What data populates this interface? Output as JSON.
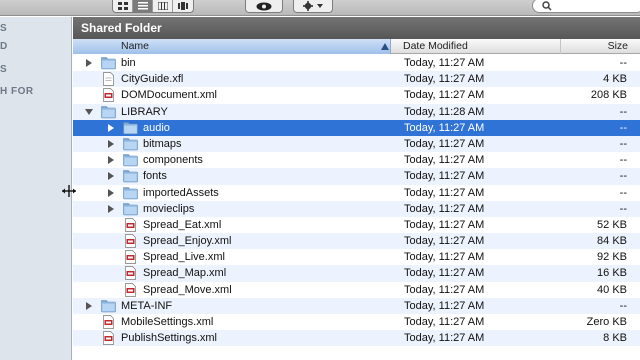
{
  "toolbar": {
    "view_buttons": [
      "icon-view",
      "list-view",
      "column-view",
      "coverflow-view"
    ],
    "active_view": 1
  },
  "sidebar": {
    "items": [
      "S",
      "D",
      "S",
      "H FOR"
    ]
  },
  "window": {
    "title": "Shared Folder"
  },
  "columns": {
    "name": "Name",
    "date": "Date Modified",
    "size": "Size"
  },
  "colors": {
    "selection": "#2f73d6",
    "title_bar": "#5e5e5e",
    "alt_row": "#edf3fe",
    "sidebar": "#dde4ec"
  },
  "rows": [
    {
      "name": "bin",
      "date": "Today, 11:27 AM",
      "size": "--",
      "type": "folder",
      "level": 0,
      "disclosure": "closed"
    },
    {
      "name": "CityGuide.xfl",
      "date": "Today, 11:27 AM",
      "size": "4 KB",
      "type": "file",
      "level": 0,
      "disclosure": "none"
    },
    {
      "name": "DOMDocument.xml",
      "date": "Today, 11:27 AM",
      "size": "208 KB",
      "type": "xml",
      "level": 0,
      "disclosure": "none"
    },
    {
      "name": "LIBRARY",
      "date": "Today, 11:28 AM",
      "size": "--",
      "type": "folder",
      "level": 0,
      "disclosure": "open"
    },
    {
      "name": "audio",
      "date": "Today, 11:27 AM",
      "size": "--",
      "type": "folder",
      "level": 1,
      "disclosure": "closed",
      "selected": true
    },
    {
      "name": "bitmaps",
      "date": "Today, 11:27 AM",
      "size": "--",
      "type": "folder",
      "level": 1,
      "disclosure": "closed"
    },
    {
      "name": "components",
      "date": "Today, 11:27 AM",
      "size": "--",
      "type": "folder",
      "level": 1,
      "disclosure": "closed"
    },
    {
      "name": "fonts",
      "date": "Today, 11:27 AM",
      "size": "--",
      "type": "folder",
      "level": 1,
      "disclosure": "closed"
    },
    {
      "name": "importedAssets",
      "date": "Today, 11:27 AM",
      "size": "--",
      "type": "folder",
      "level": 1,
      "disclosure": "closed"
    },
    {
      "name": "movieclips",
      "date": "Today, 11:27 AM",
      "size": "--",
      "type": "folder",
      "level": 1,
      "disclosure": "closed"
    },
    {
      "name": "Spread_Eat.xml",
      "date": "Today, 11:27 AM",
      "size": "52 KB",
      "type": "xml",
      "level": 1,
      "disclosure": "none"
    },
    {
      "name": "Spread_Enjoy.xml",
      "date": "Today, 11:27 AM",
      "size": "84 KB",
      "type": "xml",
      "level": 1,
      "disclosure": "none"
    },
    {
      "name": "Spread_Live.xml",
      "date": "Today, 11:27 AM",
      "size": "92 KB",
      "type": "xml",
      "level": 1,
      "disclosure": "none"
    },
    {
      "name": "Spread_Map.xml",
      "date": "Today, 11:27 AM",
      "size": "16 KB",
      "type": "xml",
      "level": 1,
      "disclosure": "none"
    },
    {
      "name": "Spread_Move.xml",
      "date": "Today, 11:27 AM",
      "size": "40 KB",
      "type": "xml",
      "level": 1,
      "disclosure": "none"
    },
    {
      "name": "META-INF",
      "date": "Today, 11:27 AM",
      "size": "--",
      "type": "folder",
      "level": 0,
      "disclosure": "closed"
    },
    {
      "name": "MobileSettings.xml",
      "date": "Today, 11:27 AM",
      "size": "Zero KB",
      "type": "xml",
      "level": 0,
      "disclosure": "none"
    },
    {
      "name": "PublishSettings.xml",
      "date": "Today, 11:27 AM",
      "size": "8 KB",
      "type": "xml",
      "level": 0,
      "disclosure": "none"
    }
  ]
}
